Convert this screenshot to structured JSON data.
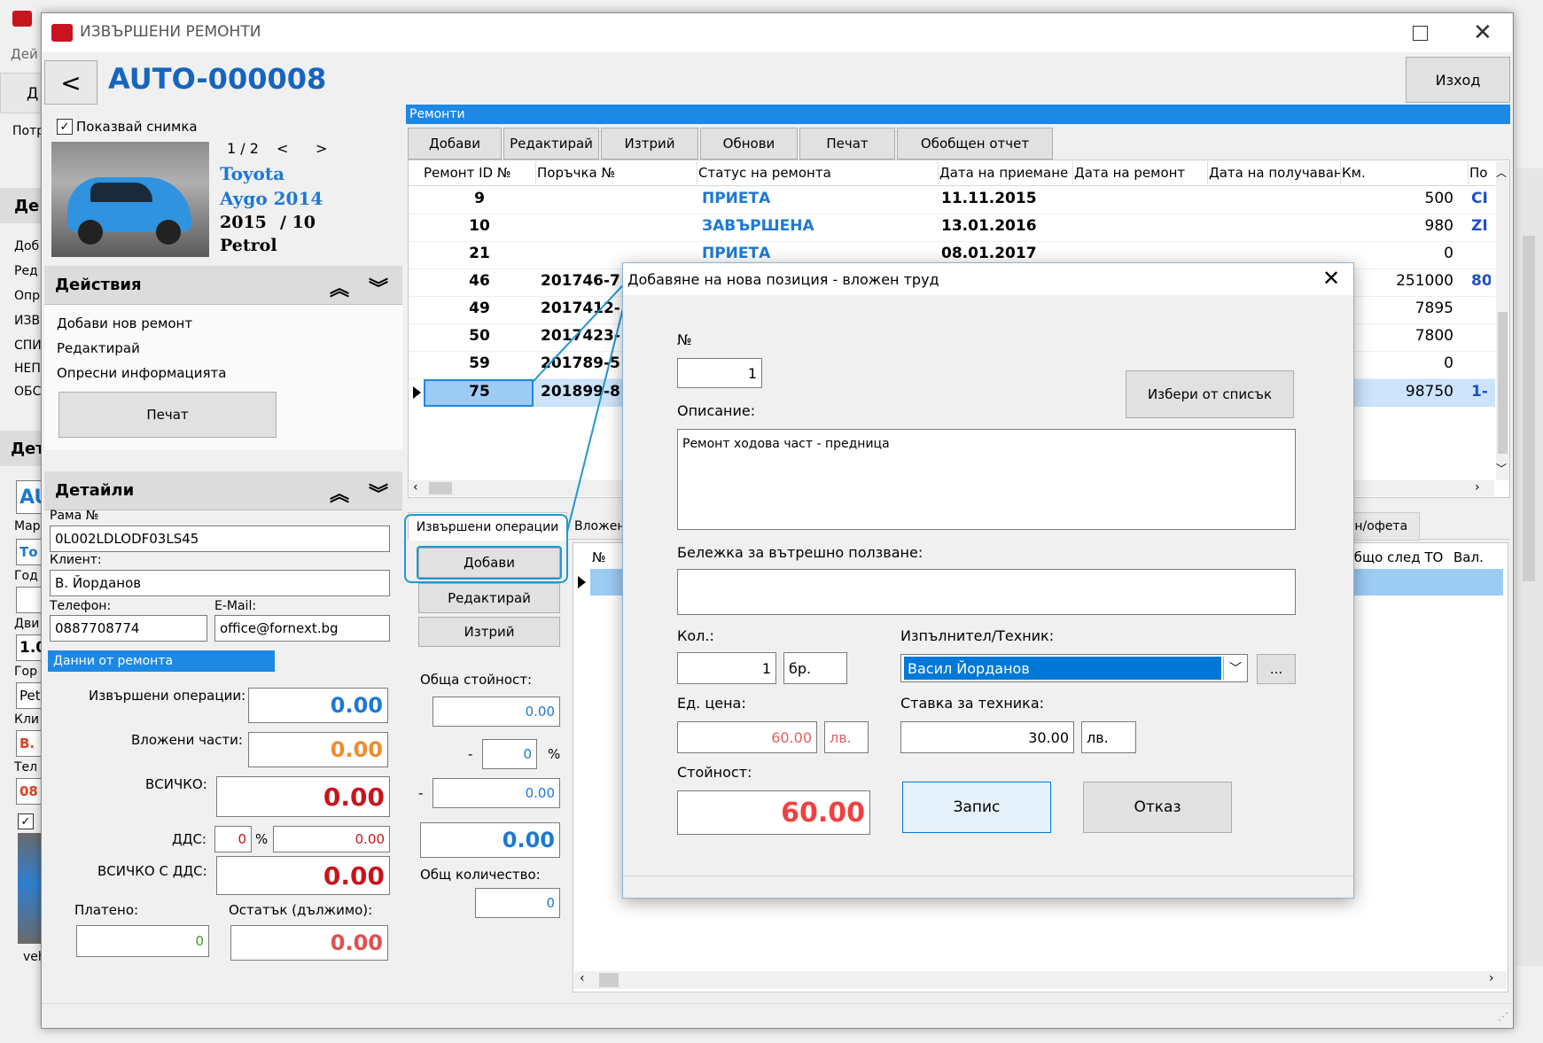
{
  "window": {
    "title": "ИЗВЪРШЕНИ РЕМОНТИ",
    "record_title": "AUTO-000008",
    "back_label": "<",
    "exit_label": "Изход"
  },
  "bg_fragments": [
    "Дей",
    "Д",
    "Потр",
    "Де",
    "Доб",
    "Ред",
    "Опр",
    "ИЗВ",
    "СПИ",
    "НЕП",
    "ОБС",
    "Дет",
    "AU",
    "Мар",
    "То",
    "Год",
    "Дви",
    "1.0",
    "Гор",
    "Pet",
    "Кли",
    "В.",
    "Тел",
    "08",
    "veh"
  ],
  "photo": {
    "show_label": "Показвай снимка",
    "counter": "1 / 2",
    "prev": "<",
    "next": ">",
    "make": "Toyota",
    "model": "Aygo 2014",
    "year": "2015",
    "month": "/ 10",
    "fuel": "Petrol"
  },
  "actions": {
    "header": "Действия",
    "items": [
      "Добави нов ремонт",
      "Редактирай",
      "Опресни информацията"
    ],
    "print_label": "Печат"
  },
  "details": {
    "header": "Детайли",
    "vin_label": "Рама №",
    "vin": "0L002LDLODF03LS45",
    "client_label": "Клиент:",
    "client": "В. Йорданов",
    "phone_label": "Телефон:",
    "phone": "0887708774",
    "email_label": "E-Mail:",
    "email": "office@fornext.bg",
    "repair_data_label": "Данни от ремонта",
    "ops_label": "Извършени операции:",
    "ops_value": "0.00",
    "parts_label": "Вложени части:",
    "parts_value": "0.00",
    "total_label": "ВСИЧКО:",
    "total_value": "0.00",
    "vat_label": "ДДС:",
    "vat_pct": "0",
    "pct": "%",
    "vat_value": "0.00",
    "total_vat_label": "ВСИЧКО С ДДС:",
    "total_vat_value": "0.00",
    "paid_label": "Платено:",
    "paid_value": "0",
    "remaining_label": "Остатък (дължимо):",
    "remaining_value": "0.00"
  },
  "repairs": {
    "header": "Ремонти",
    "toolbar": [
      "Добави",
      "Редактирай",
      "Изтрий",
      "Обнови",
      "Печат",
      "Обобщен отчет"
    ],
    "columns": [
      "Ремонт ID №",
      "Поръчка №",
      "Статус на ремонта",
      "Дата на приемане",
      "Дата на ремонт",
      "Дата на получаван",
      "Км.",
      "По"
    ],
    "rows": [
      {
        "id": "9",
        "order": "",
        "status": "ПРИЕТА",
        "date": "11.11.2015",
        "km": "500",
        "extra": "CI"
      },
      {
        "id": "10",
        "order": "",
        "status": "ЗАВЪРШЕНА",
        "date": "13.01.2016",
        "km": "980",
        "extra": "ZI"
      },
      {
        "id": "21",
        "order": "",
        "status": "ПРИЕТА",
        "date": "08.01.2017",
        "km": "0",
        "extra": ""
      },
      {
        "id": "46",
        "order": "201746-7",
        "status": "",
        "date": "",
        "km": "251000",
        "extra": "80"
      },
      {
        "id": "49",
        "order": "2017412-",
        "status": "",
        "date": "",
        "km": "7895",
        "extra": ""
      },
      {
        "id": "50",
        "order": "2017423-",
        "status": "",
        "date": "",
        "km": "7800",
        "extra": ""
      },
      {
        "id": "59",
        "order": "201789-5",
        "status": "",
        "date": "",
        "km": "0",
        "extra": ""
      },
      {
        "id": "75",
        "order": "201899-8",
        "status": "",
        "date": "",
        "km": "98750",
        "extra": "1-"
      }
    ]
  },
  "operations": {
    "tab_label": "Извършени операции",
    "tab2_label": "Вложен",
    "tab3_label": "ан/офета",
    "add_label": "Добави",
    "edit_label": "Редактирай",
    "delete_label": "Изтрий",
    "total_label": "Обща стойност:",
    "total_value": "0.00",
    "minus": "-",
    "disc_pct": "0",
    "pct": "%",
    "disc_value": "0.00",
    "net_value": "0.00",
    "qty_label": "Общ количество:",
    "qty_value": "0",
    "grid_columns": [
      "№",
      "Общо след ТО",
      "Вал."
    ]
  },
  "dialog": {
    "title": "Добавяне на нова позиция - вложен труд",
    "no_label": "№",
    "no_value": "1",
    "pick_label": "Избери от списък",
    "desc_label": "Описание:",
    "desc_value": "Ремонт ходова част - предница",
    "note_label": "Бележка за вътрешно ползване:",
    "note_value": "",
    "qty_label": "Кол.:",
    "qty_value": "1",
    "unit_value": "бр.",
    "tech_label": "Изпълнител/Техник:",
    "tech_value": "Васил Йорданов",
    "dots": "...",
    "price_label": "Ед. цена:",
    "price_value": "60.00",
    "currency": "лв.",
    "rate_label": "Ставка за техника:",
    "rate_value": "30.00",
    "rate_currency": "лв.",
    "value_label": "Стойност:",
    "value_value": "60.00",
    "save_label": "Запис",
    "cancel_label": "Отказ"
  }
}
